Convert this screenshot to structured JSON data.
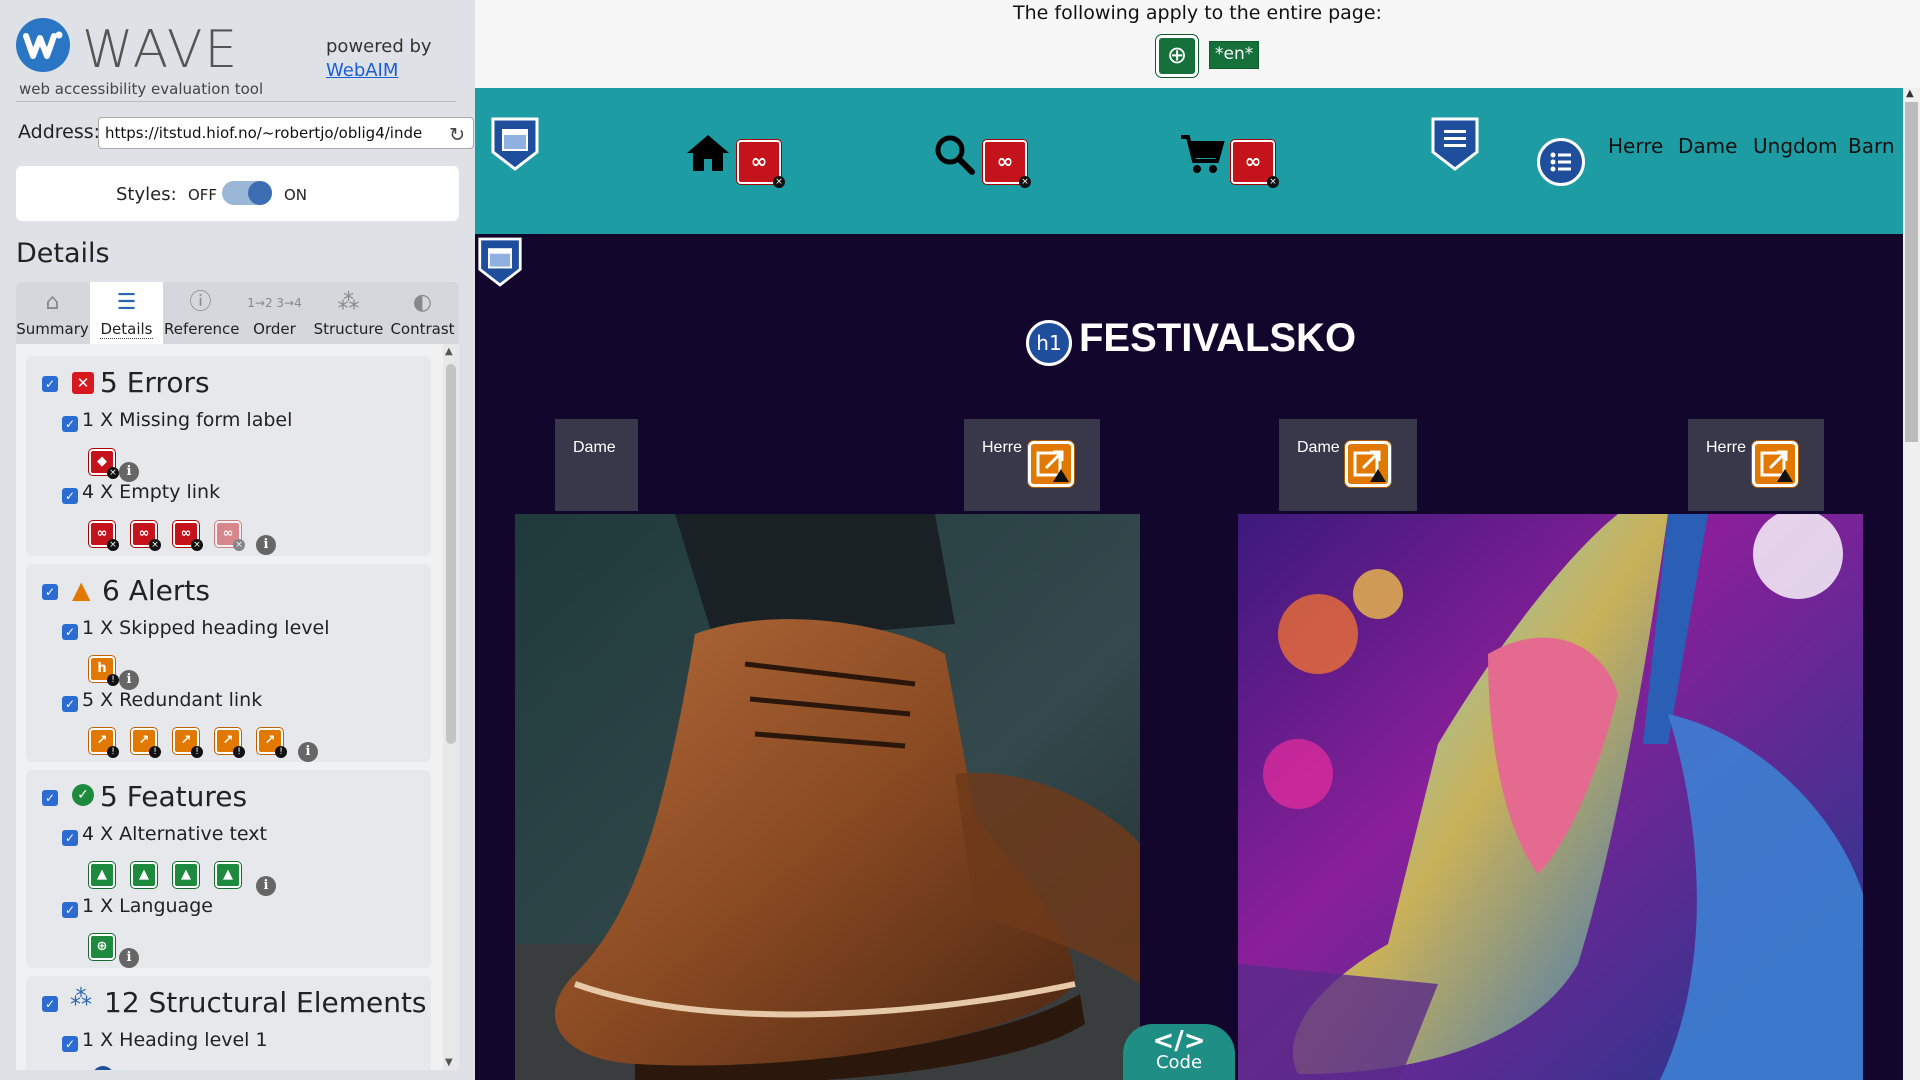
{
  "wave": {
    "brand": "WAVE",
    "tagline": "web accessibility evaluation tool",
    "powered_by": "powered by",
    "webaim": "WebAIM",
    "address_label": "Address:",
    "address_value": "https://itstud.hiof.no/~robertjo/oblig4/inde",
    "styles_label": "Styles:",
    "styles_off": "OFF",
    "styles_on": "ON",
    "details_heading": "Details",
    "tabs": [
      {
        "label": "Summary",
        "icon": "home-icon"
      },
      {
        "label": "Details",
        "icon": "list-icon"
      },
      {
        "label": "Reference",
        "icon": "info-icon"
      },
      {
        "label": "Order",
        "icon": "order-icon"
      },
      {
        "label": "Structure",
        "icon": "structure-icon"
      },
      {
        "label": "Contrast",
        "icon": "contrast-icon"
      }
    ],
    "errors": {
      "title": "5 Errors",
      "items": [
        {
          "label": "1 X Missing form label"
        },
        {
          "label": "4 X Empty link"
        }
      ]
    },
    "alerts": {
      "title": "6 Alerts",
      "items": [
        {
          "label": "1 X Skipped heading level"
        },
        {
          "label": "5 X Redundant link"
        }
      ]
    },
    "features": {
      "title": "5 Features",
      "items": [
        {
          "label": "4 X Alternative text"
        },
        {
          "label": "1 X Language"
        }
      ]
    },
    "structural": {
      "title": "12 Structural Elements",
      "items": [
        {
          "label": "1 X Heading level 1"
        }
      ]
    }
  },
  "page": {
    "notice": "The following apply to the entire page:",
    "lang_badge": "*en*",
    "nav_links": [
      "Herre",
      "Dame",
      "Ungdom",
      "Barn"
    ],
    "title": "FESTIVALSKO",
    "h1_badge": "h1",
    "tags": [
      "Dame",
      "Herre",
      "Dame",
      "Herre"
    ],
    "code_symbol": "</>",
    "code_label": "Code"
  },
  "colors": {
    "nav_bg": "#1d9ca4",
    "main_bg": "#13062c",
    "error": "#c4131a",
    "alert": "#e17800",
    "feature": "#1d8a3d",
    "accent": "#2c6bd1"
  }
}
